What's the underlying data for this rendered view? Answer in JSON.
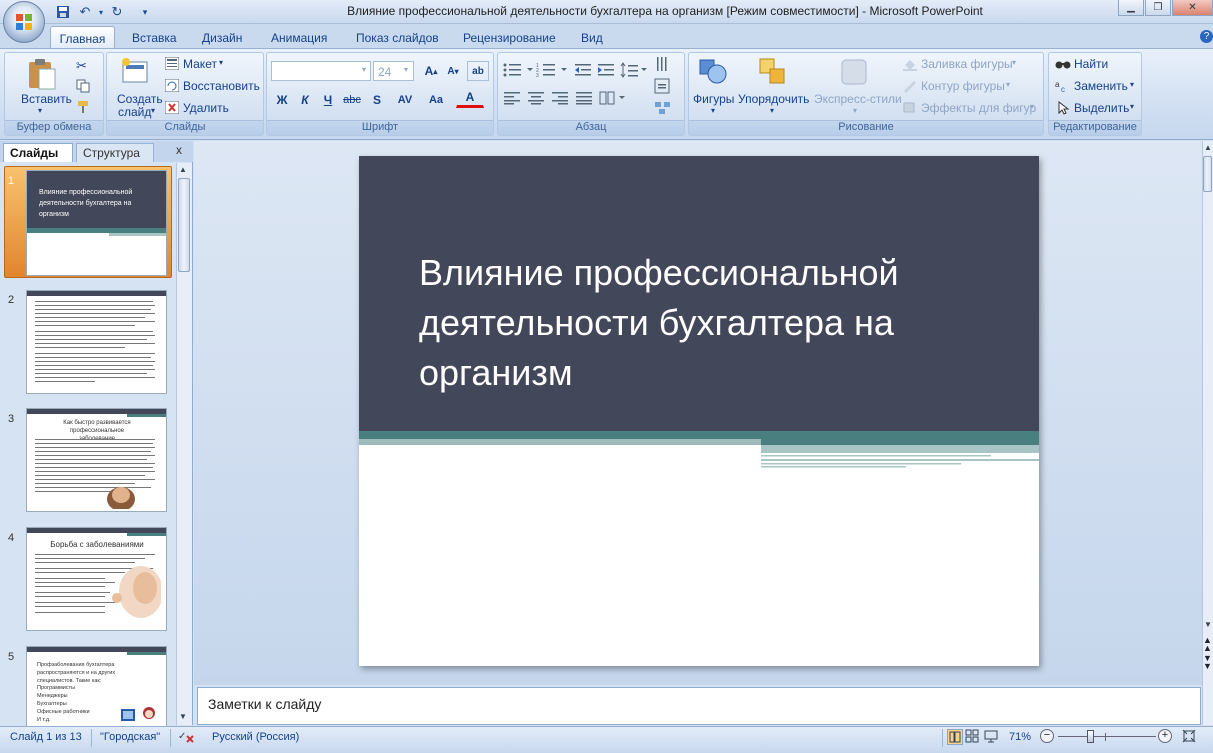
{
  "window": {
    "title": "Влияние профессиональной деятельности бухгалтера на организм [Режим совместимости] - Microsoft PowerPoint"
  },
  "tabs": [
    "Главная",
    "Вставка",
    "Дизайн",
    "Анимация",
    "Показ слайдов",
    "Рецензирование",
    "Вид"
  ],
  "ribbon": {
    "clipboard": {
      "label": "Буфер обмена",
      "paste": "Вставить"
    },
    "slides": {
      "label": "Слайды",
      "create": "Создать",
      "create2": "слайд",
      "layout": "Макет",
      "reset": "Восстановить",
      "delete": "Удалить"
    },
    "font": {
      "label": "Шрифт",
      "size": "24",
      "bold": "Ж",
      "italic": "К",
      "underline": "Ч",
      "strike": "abc",
      "shadow": "S",
      "spacing": "AV",
      "case": "Aa",
      "color": "A"
    },
    "paragraph": {
      "label": "Абзац"
    },
    "drawing": {
      "label": "Рисование",
      "shapes": "Фигуры",
      "arrange": "Упорядочить",
      "styles": "Экспресс-стили",
      "fill": "Заливка фигуры",
      "outline": "Контур фигуры",
      "effects": "Эффекты для фигур"
    },
    "editing": {
      "label": "Редактирование",
      "find": "Найти",
      "replace": "Заменить",
      "select": "Выделить"
    }
  },
  "panel": {
    "tab_slides": "Слайды",
    "tab_outline": "Структура",
    "close": "x"
  },
  "thumbnails": [
    {
      "num": "1",
      "title": "Влияние профессиональной деятельности бухгалтера на организм"
    },
    {
      "num": "2",
      "title": ""
    },
    {
      "num": "3",
      "title": "Как быстро развивается профессиональное заболевание"
    },
    {
      "num": "4",
      "title": "Борьба с заболеваниями"
    },
    {
      "num": "5",
      "title": "Профзаболевания бухгалтера распространяются и на других специалистов. Такие как:",
      "bullets": [
        "Программисты",
        "Менеджеры",
        "Бухгалтеры",
        "Офисные работники",
        "И т.д."
      ]
    }
  ],
  "slide": {
    "title": "Влияние профессиональной деятельности бухгалтера на организм"
  },
  "notes": {
    "placeholder": "Заметки к слайду"
  },
  "status": {
    "slide": "Слайд 1 из 13",
    "theme": "\"Городская\"",
    "language": "Русский (Россия)",
    "zoom": "71%"
  },
  "colors": {
    "slide_dark": "#43475a",
    "teal": "#4a7f80",
    "accent_orange": "#e4a048"
  }
}
